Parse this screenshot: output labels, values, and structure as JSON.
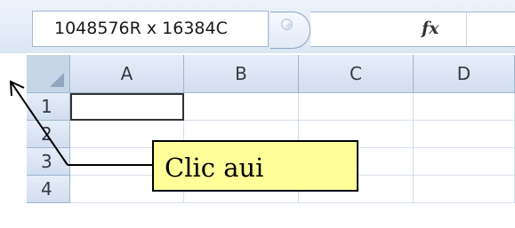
{
  "formula_bar": {
    "name_box_value": "1048576R x 16384C",
    "fx_label": "fx"
  },
  "grid": {
    "column_headers": [
      "A",
      "B",
      "C",
      "D"
    ],
    "row_headers": [
      "1",
      "2",
      "3",
      "4"
    ],
    "active_cell": "A1"
  },
  "callout": {
    "text": "Clic aui"
  },
  "colors": {
    "header_bg": "#d2ddee",
    "callout_bg": "#ffff99"
  }
}
